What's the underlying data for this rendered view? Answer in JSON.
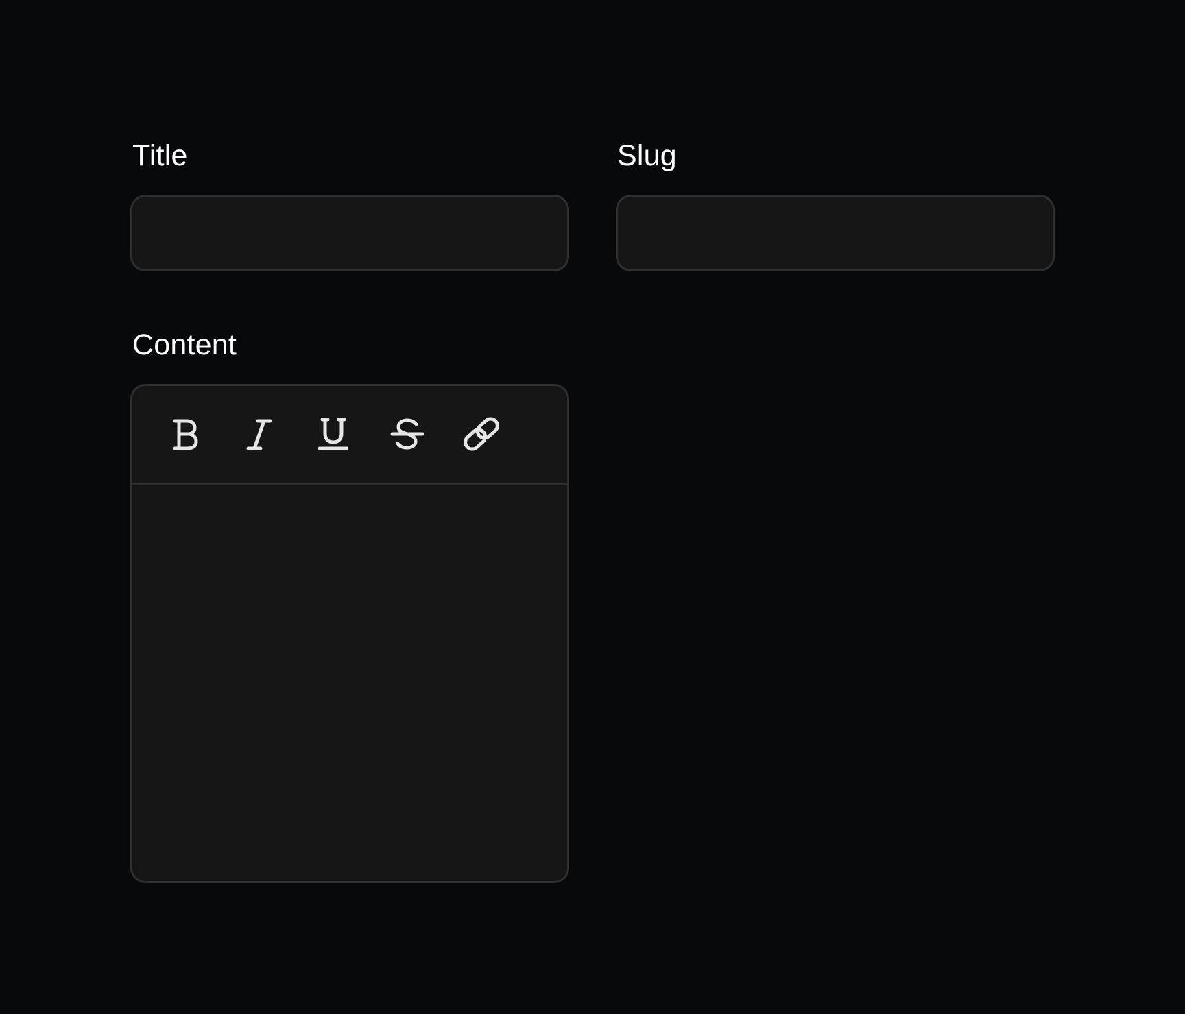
{
  "form": {
    "title_label": "Title",
    "title_value": "",
    "slug_label": "Slug",
    "slug_value": "",
    "content_label": "Content",
    "content_value": ""
  },
  "toolbar": {
    "tools": [
      {
        "name": "bold",
        "icon": "bold-icon"
      },
      {
        "name": "italic",
        "icon": "italic-icon"
      },
      {
        "name": "underline",
        "icon": "underline-icon"
      },
      {
        "name": "strikethrough",
        "icon": "strikethrough-icon"
      },
      {
        "name": "link",
        "icon": "link-icon"
      }
    ]
  },
  "colors": {
    "background": "#08090b",
    "field_background": "#161616",
    "border": "#2f2f31",
    "text": "#ffffff",
    "icon": "#e6e6e6"
  }
}
